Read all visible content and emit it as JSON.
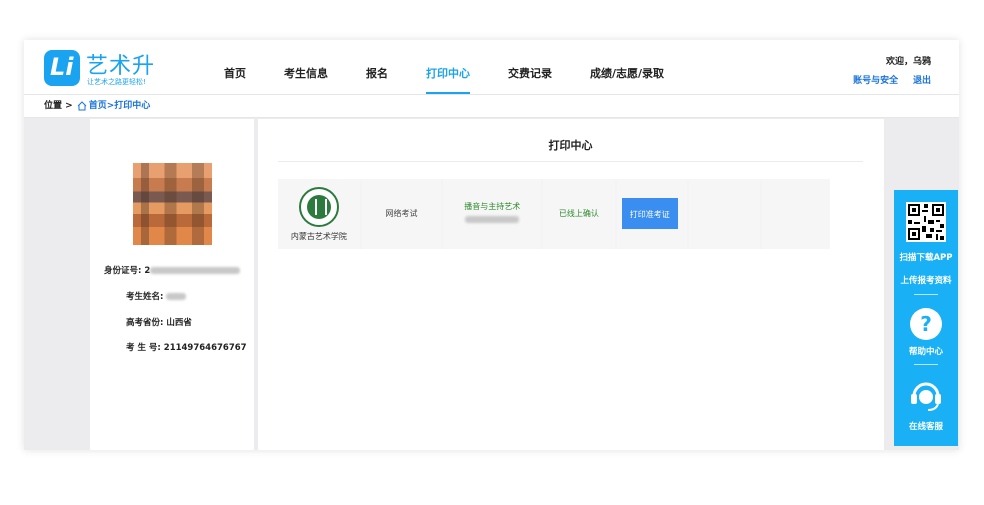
{
  "logo": {
    "title": "艺术升",
    "subtitle": "让艺术之路更轻松!",
    "mark": "Li"
  },
  "nav": [
    {
      "label": "首页",
      "active": false
    },
    {
      "label": "考生信息",
      "active": false
    },
    {
      "label": "报名",
      "active": false
    },
    {
      "label": "打印中心",
      "active": true
    },
    {
      "label": "交费记录",
      "active": false
    },
    {
      "label": "成绩/志愿/录取",
      "active": false
    }
  ],
  "user": {
    "welcome": "欢迎，乌鸦",
    "account_link": "账号与安全",
    "logout_link": "退出"
  },
  "breadcrumb": {
    "prefix": "位置 >",
    "home": "首页",
    "current": ">打印中心"
  },
  "profile": {
    "id_label": "身份证号: 2",
    "name_label": "考生姓名:",
    "province_label": "高考省份: 山西省",
    "exam_no_label": "考 生 号: 21149764676767"
  },
  "main": {
    "title": "打印中心",
    "row": {
      "school": "内蒙古艺术学院",
      "exam_type": "网络考试",
      "major": "播音与主持艺术",
      "status": "已线上确认",
      "print_button": "打印准考证"
    }
  },
  "sidebar": {
    "download_app": "扫描下载APP",
    "upload": "上传报考资料",
    "help": "帮助中心",
    "help_glyph": "?",
    "service": "在线客服"
  },
  "colors": {
    "brand": "#1aa3f0",
    "sidebar": "#1ab0f5",
    "button": "#3a8ef0",
    "school_green": "#2d7a3e"
  }
}
